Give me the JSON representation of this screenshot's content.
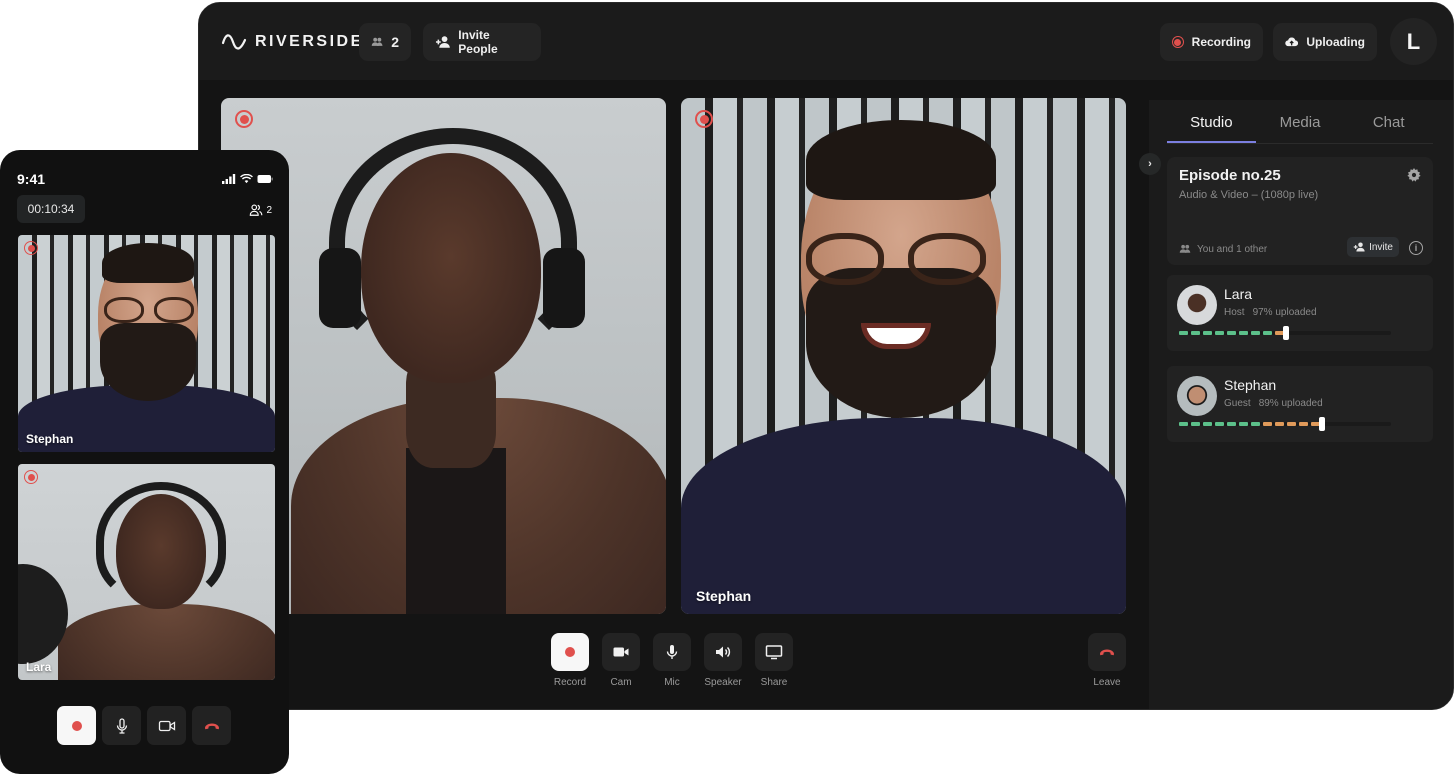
{
  "colors": {
    "accent": "#7b7fe0",
    "record_red": "#e0504d",
    "upload_green": "#5cc08a",
    "upload_orange": "#e09a5a",
    "window_bg": "#141414",
    "panel_bg": "#1b1b1b"
  },
  "desktop": {
    "header": {
      "brand": "RIVERSIDE",
      "participant_count": "2",
      "invite_label": "Invite People",
      "recording_label": "Recording",
      "uploading_label": "Uploading",
      "avatar_initial": "L"
    },
    "tiles": [
      {
        "name": "",
        "recording": true
      },
      {
        "name": "Stephan",
        "recording": true
      }
    ],
    "controls": [
      {
        "id": "record",
        "label": "Record",
        "icon": "record-icon"
      },
      {
        "id": "cam",
        "label": "Cam",
        "icon": "camera-icon"
      },
      {
        "id": "mic",
        "label": "Mic",
        "icon": "microphone-icon"
      },
      {
        "id": "speaker",
        "label": "Speaker",
        "icon": "speaker-icon"
      },
      {
        "id": "share",
        "label": "Share",
        "icon": "screen-share-icon"
      }
    ],
    "leave_label": "Leave",
    "sidebar": {
      "tabs": [
        {
          "label": "Studio",
          "active": true
        },
        {
          "label": "Media",
          "active": false
        },
        {
          "label": "Chat",
          "active": false
        }
      ],
      "episode": {
        "title": "Episode no.25",
        "subtitle": "Audio & Video – (1080p live)",
        "people": "You and 1 other",
        "invite_label": "Invite",
        "info_glyph": "i"
      },
      "participants": [
        {
          "name": "Lara",
          "role": "Host",
          "status": "97% uploaded",
          "green_segments": 8,
          "orange_segments": 1,
          "progress": 0.97
        },
        {
          "name": "Stephan",
          "role": "Guest",
          "status": "89% uploaded",
          "green_segments": 7,
          "orange_segments": 5,
          "progress": 0.89
        }
      ]
    }
  },
  "phone": {
    "time": "9:41",
    "timer": "00:10:34",
    "participant_count": "2",
    "tiles": [
      {
        "name": "Stephan",
        "recording": true
      },
      {
        "name": "Lara",
        "recording": true
      }
    ]
  }
}
